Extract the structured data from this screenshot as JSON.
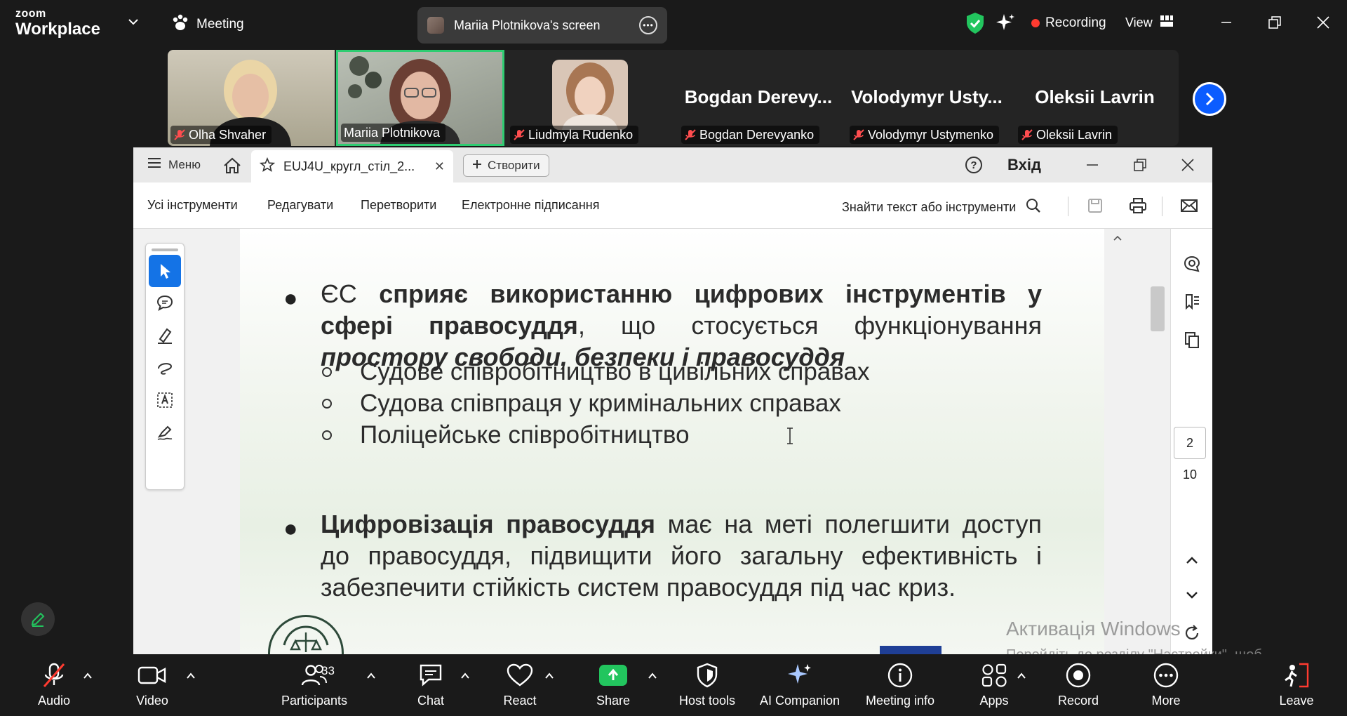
{
  "zoom": {
    "brand_small": "zoom",
    "brand_big": "Workplace",
    "meeting_label": "Meeting",
    "screen_share_label": "Mariia Plotnikova's screen",
    "recording_label": "Recording",
    "view_label": "View",
    "colors": {
      "accent": "#0b5cff",
      "recording": "#ff3b30",
      "share": "#22c55e",
      "shield": "#22c55e"
    }
  },
  "participants_strip": {
    "tiles": [
      {
        "name": "Olha Shvaher",
        "muted": true,
        "video": true
      },
      {
        "name": "Mariia Plotnikova",
        "muted": false,
        "video": true,
        "active_speaker": true
      },
      {
        "name": "Liudmyla Rudenko",
        "muted": true,
        "video": true
      },
      {
        "name": "Bogdan Derevyanko",
        "display": "Bogdan  Derevy...",
        "muted": true,
        "video": false
      },
      {
        "name": "Volodymyr Ustymenko",
        "display": "Volodymyr  Usty...",
        "muted": true,
        "video": false
      },
      {
        "name": "Oleksii Lavrin",
        "display": "Oleksii Lavrin",
        "muted": true,
        "video": false
      }
    ]
  },
  "acrobat": {
    "menu_label": "Меню",
    "tab_title": "EUJ4U_кругл_стіл_2...",
    "create_label": "Створити",
    "login_label": "Вхід",
    "toolbar": {
      "all_tools": "Усі інструменти",
      "edit": "Редагувати",
      "convert": "Перетворити",
      "e_sign": "Електронне підписання",
      "find": "Знайти текст або інструменти"
    },
    "page_current": "2",
    "page_total": "10"
  },
  "document": {
    "bullet1": {
      "prefix": "ЄС ",
      "bold1": "сприяє використанню цифрових інструментів у сфері правосуддя",
      "middle": ", що стосується функціонування ",
      "bold_italic": "простору свободи, безпеки і правосуддя"
    },
    "subitems": [
      "Судове співробітництво в цивільних справах",
      "Судова співпраця у кримінальних справах",
      "Поліцейське співробітництво"
    ],
    "bullet2": {
      "bold": "Цифровізація правосуддя",
      "rest": " має на меті полегшити доступ до правосуддя, підвищити його загальну ефективність і забезпечити стійкість систем правосуддя під час криз."
    }
  },
  "windows_watermark": {
    "line1": "Активація Windows",
    "line2": "Перейдіть до розділу \"Настройки\", щоб активувати Windows."
  },
  "bottom_bar": {
    "audio": "Audio",
    "video": "Video",
    "participants": "Participants",
    "participants_count": "33",
    "chat": "Chat",
    "react": "React",
    "share": "Share",
    "host_tools": "Host tools",
    "ai_companion": "AI Companion",
    "meeting_info": "Meeting info",
    "apps": "Apps",
    "record": "Record",
    "more": "More",
    "leave": "Leave"
  }
}
